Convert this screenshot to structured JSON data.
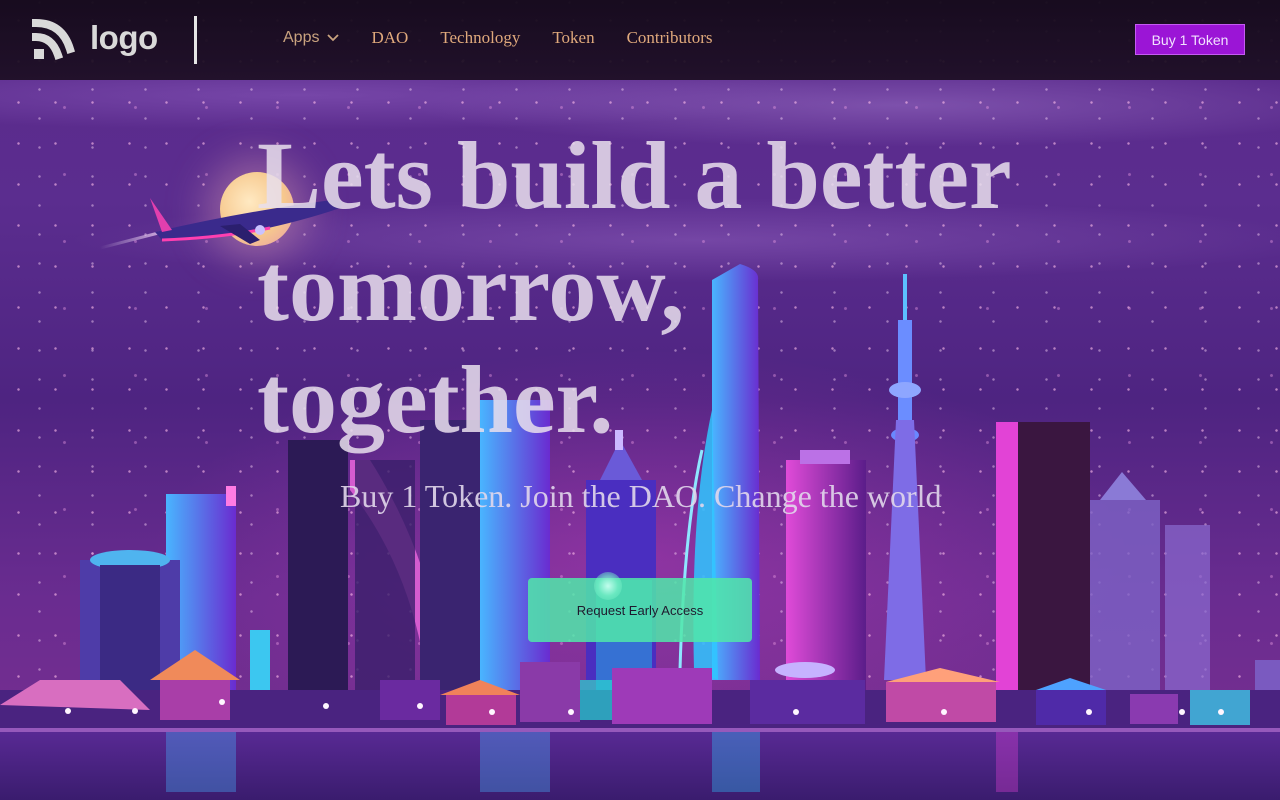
{
  "header": {
    "logo_text": "logo",
    "nav": [
      {
        "label": "Apps",
        "has_dropdown": true
      },
      {
        "label": "DAO"
      },
      {
        "label": "Technology"
      },
      {
        "label": "Token"
      },
      {
        "label": "Contributors"
      }
    ],
    "buy_button": "Buy 1 Token"
  },
  "hero": {
    "title": "Lets build a better tomorrow, together.",
    "subtitle": "Buy 1 Token. Join the DAO. Change the world",
    "cta": "Request Early Access"
  },
  "colors": {
    "header_bg": "#1a0d1f",
    "nav_text": "#e0a97c",
    "buy_button_bg": "#9b15d6",
    "cta_bg": "#50e6aa",
    "hero_text": "#e8deec"
  },
  "icons": [
    "logo-mark-icon",
    "chevron-down-icon",
    "airplane-icon"
  ]
}
